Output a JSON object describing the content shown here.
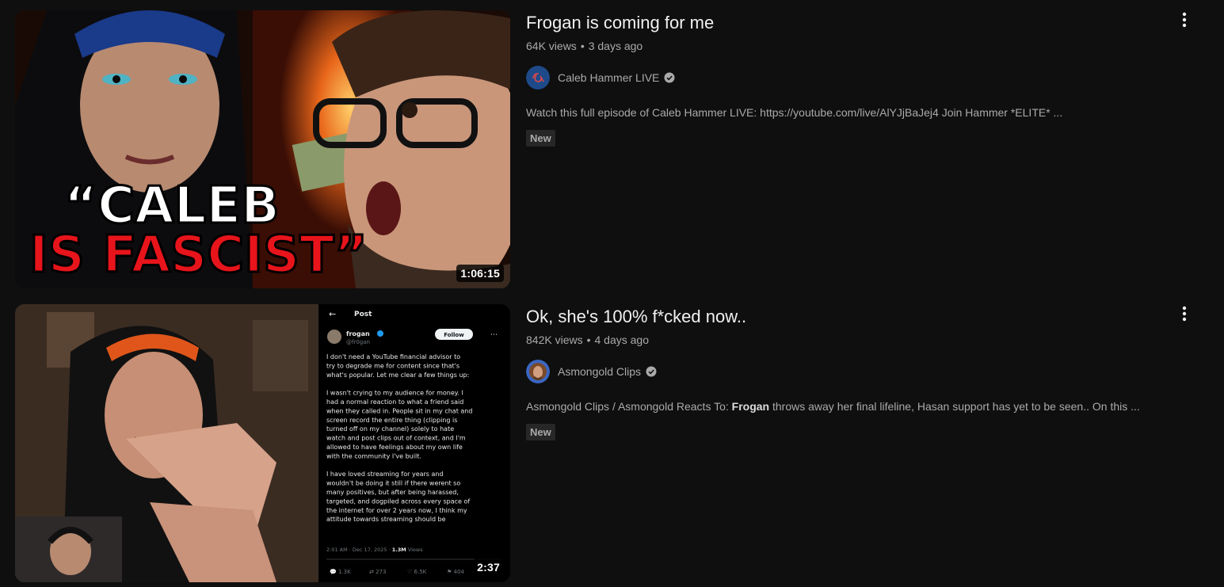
{
  "results": [
    {
      "title": "Frogan is coming for me",
      "views": "64K views",
      "age": "3 days ago",
      "channel": "Caleb Hammer LIVE",
      "description": "Watch this full episode of Caleb Hammer LIVE: https://youtube.com/live/AlYJjBaJej4 Join Hammer *ELITE* ...",
      "badge": "New",
      "duration": "1:06:15",
      "thumb_text_line1": "“CALEB",
      "thumb_text_line2": "IS FASCIST”"
    },
    {
      "title": "Ok, she's 100% f*cked now..",
      "views": "842K views",
      "age": "4 days ago",
      "channel": "Asmongold Clips",
      "description_before": "Asmongold Clips / Asmongold Reacts To: ",
      "description_bold": "Frogan",
      "description_after": " throws away her final lifeline, Hasan support has yet to be seen.. On this ...",
      "badge": "New",
      "duration": "2:37",
      "post": {
        "header": "Post",
        "name": "frogan",
        "handle": "@fr0gan",
        "follow": "Follow",
        "para1": [
          "I don't need a YouTube financial advisor to",
          "try to degrade me for content since that's",
          "what's popular. Let me clear a few things up:"
        ],
        "para2": [
          "I wasn't crying to my audience for money. I",
          "had a normal reaction to what a friend said",
          "when they called in. People sit in my chat and",
          "screen record the entire thing (clipping is",
          "turned off on my channel) solely to hate",
          "watch and post clips out of context, and I'm",
          "allowed to have feelings about my own life",
          "with the community I've built."
        ],
        "para3": [
          "I have loved streaming for years and",
          "wouldn't be doing it still if there werent so",
          "many positives, but after being harassed,",
          "targeted, and dogpiled across every space of",
          "the internet for over 2 years now, I think my",
          "attitude towards streaming should be"
        ],
        "timestamp": "2:01 AM · Dec 17, 2025 · ",
        "view_count": "1.3M",
        "view_label": " Views",
        "replies": "1.3K",
        "reposts": "273",
        "likes": "6.5K",
        "bookmarks": "404"
      }
    }
  ],
  "colors": {
    "background": "#0f0f0f",
    "title": "#f1f1f1",
    "secondary": "#aaaaaa",
    "badge_bg": "#272727",
    "thumb_red": "#e8141b"
  }
}
